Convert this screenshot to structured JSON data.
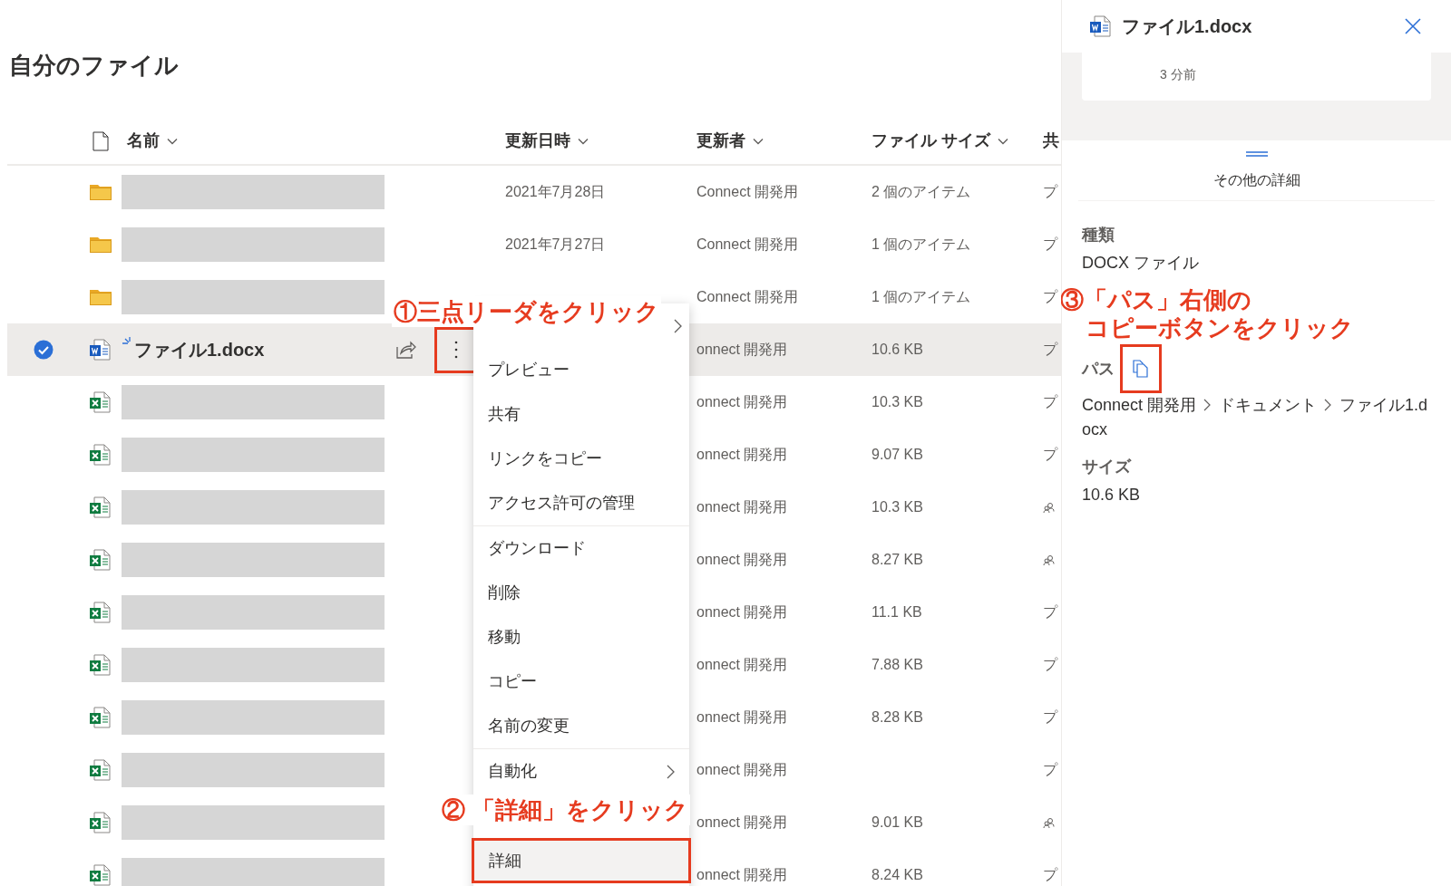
{
  "page_title": "自分のファイル",
  "columns": [
    {
      "label": "名前",
      "sortable": true
    },
    {
      "label": "更新日時",
      "sortable": true
    },
    {
      "label": "更新者",
      "sortable": true
    },
    {
      "label": "ファイル サイズ",
      "sortable": true
    },
    {
      "label": "共",
      "sortable": false
    }
  ],
  "rows": [
    {
      "kind": "folder",
      "selected": false,
      "modified": "2021年7月28日",
      "modified_by": "Connect 開発用",
      "size": "2 個のアイテム",
      "shared": {
        "kind": "text",
        "text": "プ"
      }
    },
    {
      "kind": "folder",
      "selected": false,
      "modified": "2021年7月27日",
      "modified_by": "Connect 開発用",
      "size": "1 個のアイテム",
      "shared": {
        "kind": "text",
        "text": "プ"
      }
    },
    {
      "kind": "folder",
      "selected": false,
      "modified_by": "Connect 開発用",
      "size": "1 個のアイテム",
      "shared": {
        "kind": "text",
        "text": "プ"
      }
    },
    {
      "kind": "word",
      "selected": true,
      "name": "ファイル1.docx",
      "is_new": true,
      "modified_by": "onnect 開発用",
      "size": "10.6 KB",
      "shared": {
        "kind": "text",
        "text": "プ"
      }
    },
    {
      "kind": "excel",
      "selected": false,
      "modified_by": "onnect 開発用",
      "size": "10.3 KB",
      "shared": {
        "kind": "text",
        "text": "プ"
      }
    },
    {
      "kind": "excel",
      "selected": false,
      "modified_by": "onnect 開発用",
      "size": "9.07 KB",
      "shared": {
        "kind": "text",
        "text": "プ"
      }
    },
    {
      "kind": "excel",
      "selected": false,
      "modified_by": "onnect 開発用",
      "size": "10.3 KB",
      "shared": {
        "kind": "people"
      }
    },
    {
      "kind": "excel",
      "selected": false,
      "modified_by": "onnect 開発用",
      "size": "8.27 KB",
      "shared": {
        "kind": "people"
      }
    },
    {
      "kind": "excel",
      "selected": false,
      "modified_by": "onnect 開発用",
      "size": "11.1 KB",
      "shared": {
        "kind": "text",
        "text": "プ"
      }
    },
    {
      "kind": "excel",
      "selected": false,
      "modified_by": "onnect 開発用",
      "size": "7.88 KB",
      "shared": {
        "kind": "text",
        "text": "プ"
      }
    },
    {
      "kind": "excel",
      "selected": false,
      "modified_by": "onnect 開発用",
      "size": "8.28 KB",
      "shared": {
        "kind": "text",
        "text": "プ"
      }
    },
    {
      "kind": "excel",
      "selected": false,
      "modified_by": "onnect 開発用",
      "shared": {
        "kind": "text",
        "text": "プ"
      }
    },
    {
      "kind": "excel",
      "selected": false,
      "modified_by": "onnect 開発用",
      "size": "9.01 KB",
      "shared": {
        "kind": "people"
      }
    },
    {
      "kind": "excel",
      "selected": false,
      "modified_by": "onnect 開発用",
      "size": "8.24 KB",
      "shared": {
        "kind": "text",
        "text": "プ"
      }
    }
  ],
  "context_menu": [
    {
      "kind": "submenu"
    },
    {
      "kind": "item",
      "label": "プレビュー"
    },
    {
      "kind": "item",
      "label": "共有"
    },
    {
      "kind": "item",
      "label": "リンクをコピー"
    },
    {
      "kind": "item",
      "label": "アクセス許可の管理"
    },
    {
      "kind": "divider"
    },
    {
      "kind": "item",
      "label": "ダウンロード"
    },
    {
      "kind": "item",
      "label": "削除"
    },
    {
      "kind": "item",
      "label": "移動"
    },
    {
      "kind": "item",
      "label": "コピー"
    },
    {
      "kind": "item",
      "label": "名前の変更"
    },
    {
      "kind": "divider"
    },
    {
      "kind": "submenu",
      "label": "自動化"
    },
    {
      "kind": "item",
      "label": "詳細",
      "highlighted": true
    }
  ],
  "details_panel": {
    "title": "ファイル1.docx",
    "activity_time": "3 分前",
    "more_details": "その他の詳細",
    "fields": [
      {
        "kind": "text",
        "label": "種類",
        "value": "DOCX ファイル"
      },
      {
        "kind": "path",
        "label": "パス",
        "segments": [
          "Connect 開発用",
          "ドキュメント",
          "ファイル1.docx"
        ]
      },
      {
        "kind": "text",
        "label": "サイズ",
        "value": "10.6 KB"
      }
    ]
  },
  "annotations": [
    {
      "lines": [
        "①三点リーダをクリック"
      ]
    },
    {
      "lines": [
        "② 「詳細」をクリック"
      ]
    },
    {
      "lines": [
        "③「パス」右側の",
        "コピーボタンをクリック"
      ]
    }
  ]
}
